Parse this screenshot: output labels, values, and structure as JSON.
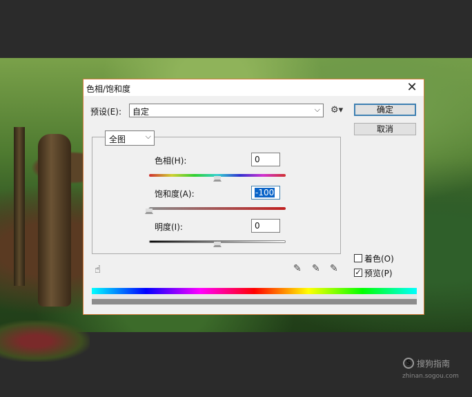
{
  "dialog": {
    "title": "色相/饱和度",
    "close_glyph": "✕",
    "preset_label": "预设(E):",
    "preset_value": "自定",
    "gear_icon": "gear-icon",
    "ok_label": "确定",
    "cancel_label": "取消",
    "channel_value": "全图",
    "hue_label": "色相(H):",
    "hue_value": "0",
    "saturation_label": "饱和度(A):",
    "saturation_value": "-100",
    "lightness_label": "明度(I):",
    "lightness_value": "0",
    "colorize_label": "着色(O)",
    "colorize_checked": false,
    "preview_label": "预览(P)",
    "preview_checked": true,
    "preview_check_glyph": "✓"
  },
  "watermark": {
    "name": "搜狗指南",
    "url": "zhinan.sogou.com",
    "logo_glyph": "S"
  }
}
